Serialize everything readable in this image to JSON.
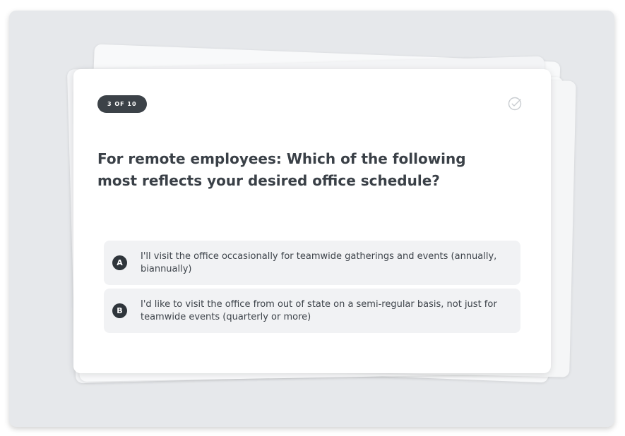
{
  "quiz": {
    "progress": "3 OF 10",
    "question": "For remote employees: Which of the following most reflects your desired office schedule?",
    "options": [
      {
        "letter": "A",
        "text": "I'll visit the office occasionally for teamwide gatherings and events (annually, biannually)"
      },
      {
        "letter": "B",
        "text": "I'd like to visit the office from out of state on a semi-regular basis, not just for teamwide events (quarterly or more)"
      }
    ]
  },
  "icons": {
    "status": "check-circle-icon"
  },
  "colors": {
    "pill_bg": "#3c4248",
    "badge_bg": "#2f353b",
    "option_bg": "#f1f2f4",
    "question_text": "#3a4047",
    "backdrop": "#e6e8eb"
  }
}
